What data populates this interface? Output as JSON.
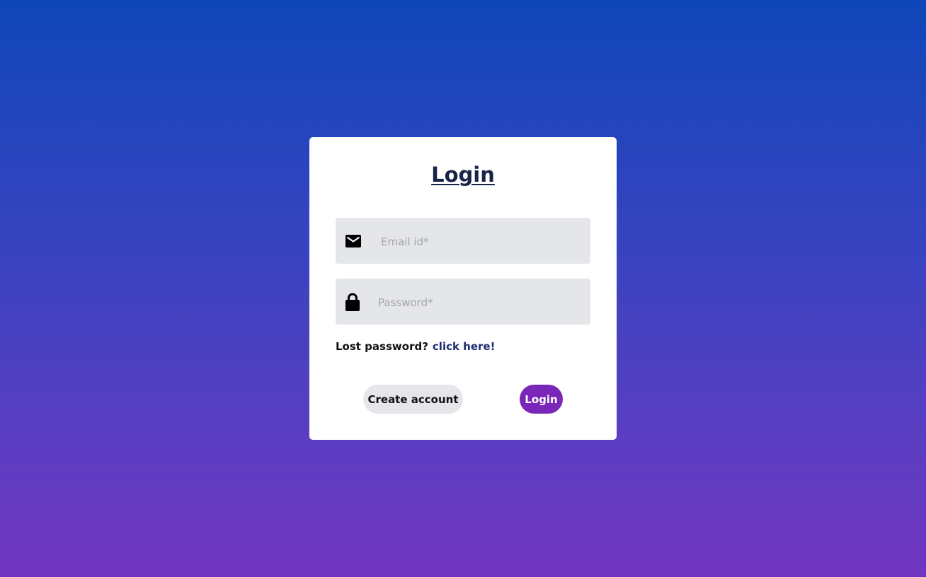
{
  "login_form": {
    "title": "Login",
    "email": {
      "placeholder": "Email id*",
      "value": "",
      "icon": "mail-icon"
    },
    "password": {
      "placeholder": "Password*",
      "value": "",
      "icon": "lock-icon"
    },
    "lost_password": {
      "text": "Lost password?",
      "link_label": "click here!"
    },
    "buttons": {
      "create_account_label": "Create account",
      "login_label": "Login"
    }
  },
  "colors": {
    "background_top": "#0f47b8",
    "background_bottom": "#7035c0",
    "card": "#ffffff",
    "field_background": "#e5e6e9",
    "login_button": "#7a26b8",
    "title": "#1a2348",
    "link": "#1d2e72"
  }
}
